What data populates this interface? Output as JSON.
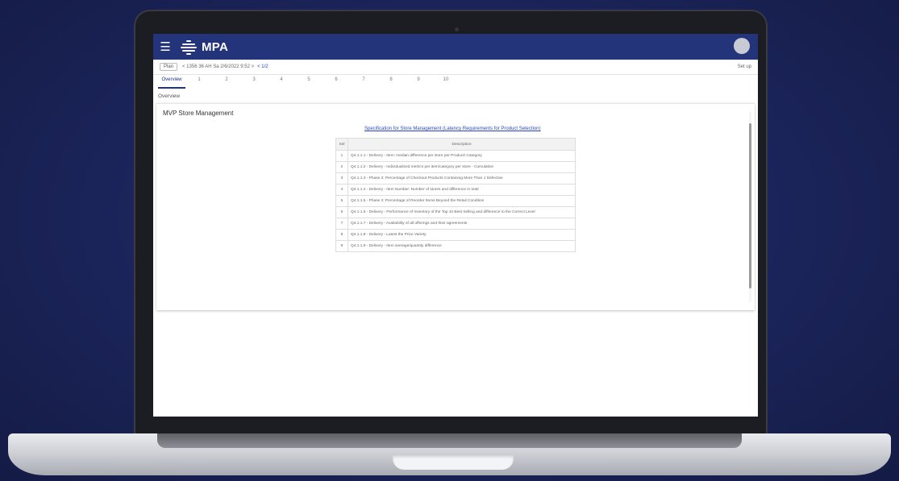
{
  "app": {
    "title": "MPA"
  },
  "toolbar": {
    "plan_select": "Plan",
    "plan_path": "< 1356 36 AH Sa 2/6/2022 9:52 >",
    "link_label": "< 1/2",
    "right_label": "Set up"
  },
  "tabs": [
    "Overview",
    "1",
    "2",
    "3",
    "4",
    "5",
    "6",
    "7",
    "8",
    "9",
    "10"
  ],
  "breadcrumb": "Overview",
  "panel": {
    "title": "MVP Store Management",
    "spec_link": "Specification for Store Management (Latency Requirements for Product Selection)"
  },
  "table": {
    "headers": [
      "Sel",
      "Description"
    ],
    "rows": [
      {
        "sel": "1",
        "desc": "Q4.1.1.1 - Delivery - Item: median difference per store per Product/ Category"
      },
      {
        "sel": "2",
        "desc": "Q4.1.1.2 - Delivery - Individualized metrics per item/category per store - Cumulative"
      },
      {
        "sel": "3",
        "desc": "Q4.1.1.3 - Phase 2: Percentage of Checkout Products Containing More Than 1 Defective"
      },
      {
        "sel": "4",
        "desc": "Q4.1.1.4 - Delivery - Item Number: Number of stores and difference in total"
      },
      {
        "sel": "5",
        "desc": "Q4.1.1.5 - Phase 2: Percentage of Reorder Items Beyond the Retail Condition"
      },
      {
        "sel": "6",
        "desc": "Q4.1.1.6 - Delivery - Performance of Inventory of the Top 10 Best Selling and difference to the Correct Level"
      },
      {
        "sel": "7",
        "desc": "Q4.1.1.7 - Delivery - Availability of all offerings and their agreements"
      },
      {
        "sel": "8",
        "desc": "Q4.1.1.8 - Delivery - Latest the Price Variety"
      },
      {
        "sel": "9",
        "desc": "Q4.1.1.9 - Delivery - Item average/quantity difference"
      }
    ]
  },
  "colors": {
    "appbar": "#23347a",
    "link": "#2a47c2",
    "background": "#1b2459"
  }
}
